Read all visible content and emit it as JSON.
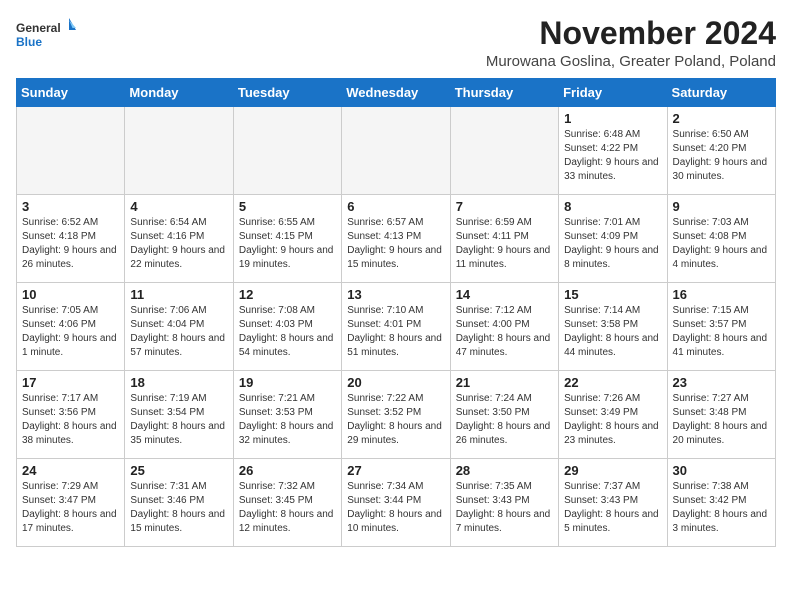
{
  "header": {
    "logo_line1": "General",
    "logo_line2": "Blue",
    "month": "November 2024",
    "location": "Murowana Goslina, Greater Poland, Poland"
  },
  "weekdays": [
    "Sunday",
    "Monday",
    "Tuesday",
    "Wednesday",
    "Thursday",
    "Friday",
    "Saturday"
  ],
  "weeks": [
    [
      {
        "day": "",
        "info": ""
      },
      {
        "day": "",
        "info": ""
      },
      {
        "day": "",
        "info": ""
      },
      {
        "day": "",
        "info": ""
      },
      {
        "day": "",
        "info": ""
      },
      {
        "day": "1",
        "info": "Sunrise: 6:48 AM\nSunset: 4:22 PM\nDaylight: 9 hours and 33 minutes."
      },
      {
        "day": "2",
        "info": "Sunrise: 6:50 AM\nSunset: 4:20 PM\nDaylight: 9 hours and 30 minutes."
      }
    ],
    [
      {
        "day": "3",
        "info": "Sunrise: 6:52 AM\nSunset: 4:18 PM\nDaylight: 9 hours and 26 minutes."
      },
      {
        "day": "4",
        "info": "Sunrise: 6:54 AM\nSunset: 4:16 PM\nDaylight: 9 hours and 22 minutes."
      },
      {
        "day": "5",
        "info": "Sunrise: 6:55 AM\nSunset: 4:15 PM\nDaylight: 9 hours and 19 minutes."
      },
      {
        "day": "6",
        "info": "Sunrise: 6:57 AM\nSunset: 4:13 PM\nDaylight: 9 hours and 15 minutes."
      },
      {
        "day": "7",
        "info": "Sunrise: 6:59 AM\nSunset: 4:11 PM\nDaylight: 9 hours and 11 minutes."
      },
      {
        "day": "8",
        "info": "Sunrise: 7:01 AM\nSunset: 4:09 PM\nDaylight: 9 hours and 8 minutes."
      },
      {
        "day": "9",
        "info": "Sunrise: 7:03 AM\nSunset: 4:08 PM\nDaylight: 9 hours and 4 minutes."
      }
    ],
    [
      {
        "day": "10",
        "info": "Sunrise: 7:05 AM\nSunset: 4:06 PM\nDaylight: 9 hours and 1 minute."
      },
      {
        "day": "11",
        "info": "Sunrise: 7:06 AM\nSunset: 4:04 PM\nDaylight: 8 hours and 57 minutes."
      },
      {
        "day": "12",
        "info": "Sunrise: 7:08 AM\nSunset: 4:03 PM\nDaylight: 8 hours and 54 minutes."
      },
      {
        "day": "13",
        "info": "Sunrise: 7:10 AM\nSunset: 4:01 PM\nDaylight: 8 hours and 51 minutes."
      },
      {
        "day": "14",
        "info": "Sunrise: 7:12 AM\nSunset: 4:00 PM\nDaylight: 8 hours and 47 minutes."
      },
      {
        "day": "15",
        "info": "Sunrise: 7:14 AM\nSunset: 3:58 PM\nDaylight: 8 hours and 44 minutes."
      },
      {
        "day": "16",
        "info": "Sunrise: 7:15 AM\nSunset: 3:57 PM\nDaylight: 8 hours and 41 minutes."
      }
    ],
    [
      {
        "day": "17",
        "info": "Sunrise: 7:17 AM\nSunset: 3:56 PM\nDaylight: 8 hours and 38 minutes."
      },
      {
        "day": "18",
        "info": "Sunrise: 7:19 AM\nSunset: 3:54 PM\nDaylight: 8 hours and 35 minutes."
      },
      {
        "day": "19",
        "info": "Sunrise: 7:21 AM\nSunset: 3:53 PM\nDaylight: 8 hours and 32 minutes."
      },
      {
        "day": "20",
        "info": "Sunrise: 7:22 AM\nSunset: 3:52 PM\nDaylight: 8 hours and 29 minutes."
      },
      {
        "day": "21",
        "info": "Sunrise: 7:24 AM\nSunset: 3:50 PM\nDaylight: 8 hours and 26 minutes."
      },
      {
        "day": "22",
        "info": "Sunrise: 7:26 AM\nSunset: 3:49 PM\nDaylight: 8 hours and 23 minutes."
      },
      {
        "day": "23",
        "info": "Sunrise: 7:27 AM\nSunset: 3:48 PM\nDaylight: 8 hours and 20 minutes."
      }
    ],
    [
      {
        "day": "24",
        "info": "Sunrise: 7:29 AM\nSunset: 3:47 PM\nDaylight: 8 hours and 17 minutes."
      },
      {
        "day": "25",
        "info": "Sunrise: 7:31 AM\nSunset: 3:46 PM\nDaylight: 8 hours and 15 minutes."
      },
      {
        "day": "26",
        "info": "Sunrise: 7:32 AM\nSunset: 3:45 PM\nDaylight: 8 hours and 12 minutes."
      },
      {
        "day": "27",
        "info": "Sunrise: 7:34 AM\nSunset: 3:44 PM\nDaylight: 8 hours and 10 minutes."
      },
      {
        "day": "28",
        "info": "Sunrise: 7:35 AM\nSunset: 3:43 PM\nDaylight: 8 hours and 7 minutes."
      },
      {
        "day": "29",
        "info": "Sunrise: 7:37 AM\nSunset: 3:43 PM\nDaylight: 8 hours and 5 minutes."
      },
      {
        "day": "30",
        "info": "Sunrise: 7:38 AM\nSunset: 3:42 PM\nDaylight: 8 hours and 3 minutes."
      }
    ]
  ]
}
